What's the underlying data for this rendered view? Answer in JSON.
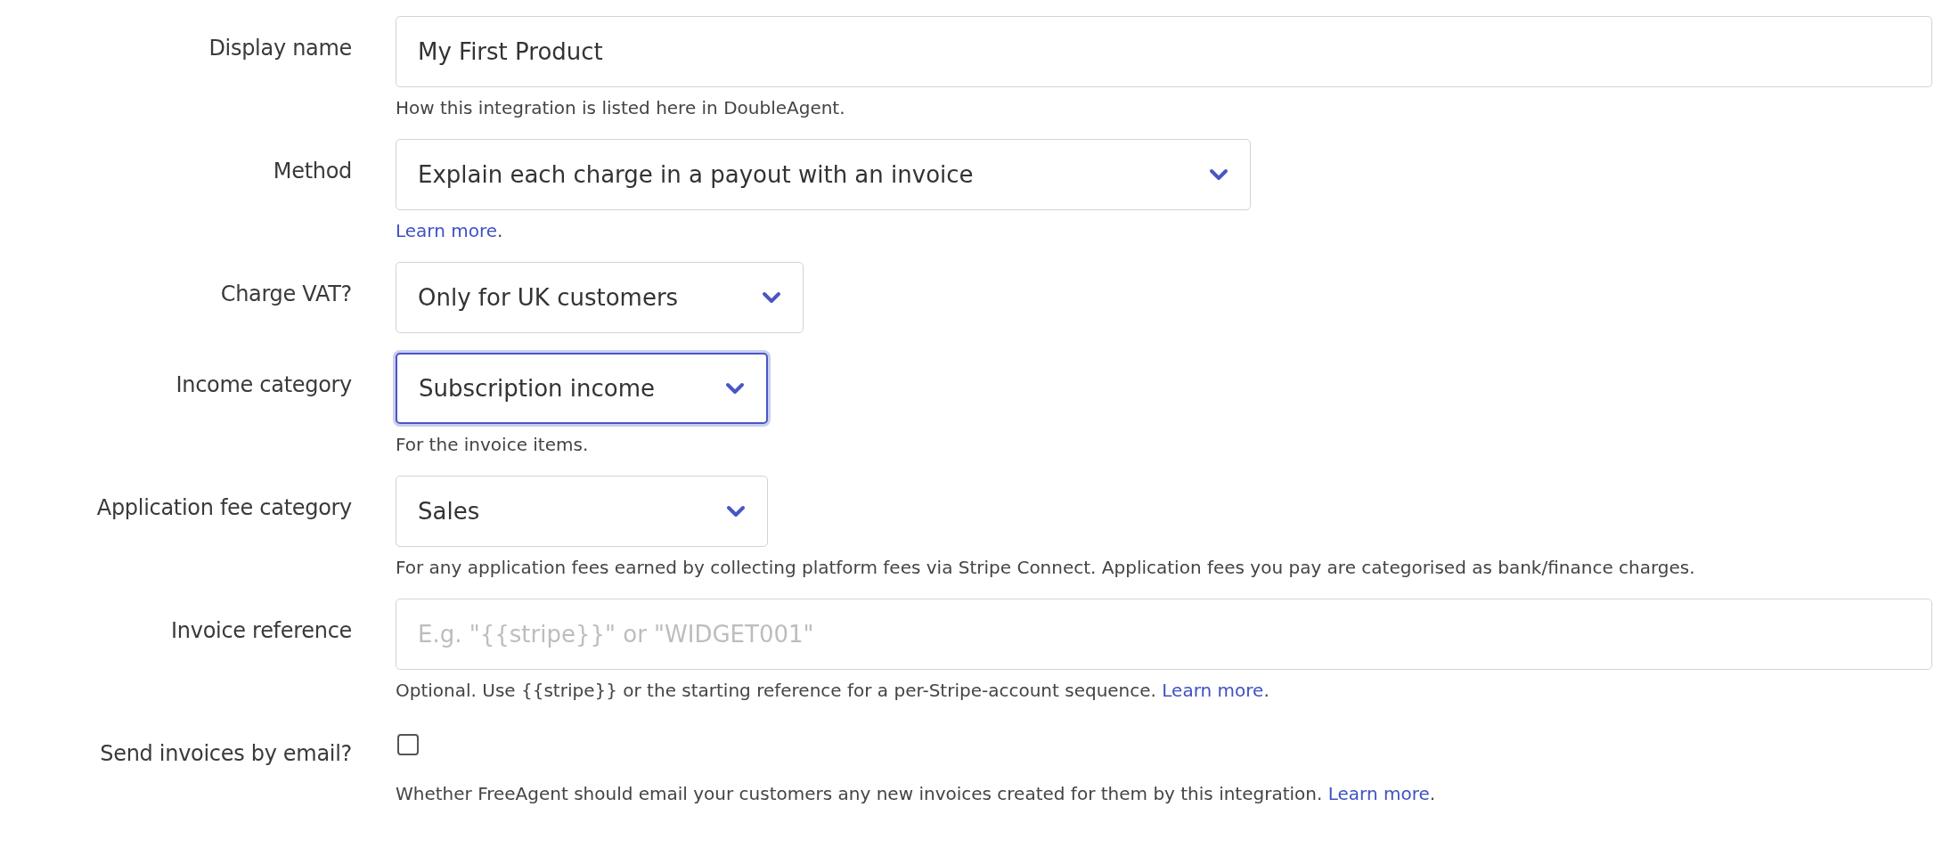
{
  "fields": [
    {
      "kind": "text",
      "label": "Display name",
      "value": "My First Product",
      "help": [
        {
          "kind": "text",
          "text": "How this integration is listed here in DoubleAgent."
        }
      ]
    },
    {
      "kind": "select",
      "label": "Method",
      "value": "Explain each charge in a payout with an invoice",
      "focused": false,
      "help": [
        {
          "kind": "link",
          "text": "Learn more"
        },
        {
          "kind": "text",
          "text": "."
        }
      ]
    },
    {
      "kind": "select",
      "label": "Charge VAT?",
      "value": "Only for UK customers",
      "focused": false
    },
    {
      "kind": "select",
      "label": "Income category",
      "value": "Subscription income",
      "focused": true,
      "help": [
        {
          "kind": "text",
          "text": "For the invoice items."
        }
      ]
    },
    {
      "kind": "select",
      "label": "Application fee category",
      "value": "Sales",
      "focused": false,
      "help": [
        {
          "kind": "text",
          "text": "For any application fees earned by collecting platform fees via Stripe Connect. Application fees you pay are categorised as bank/finance charges."
        }
      ]
    },
    {
      "kind": "text",
      "label": "Invoice reference",
      "placeholder": "E.g. \"{{stripe}}\" or \"WIDGET001\"",
      "help": [
        {
          "kind": "text",
          "text": "Optional. Use {{stripe}} or the starting reference for a per-Stripe-account sequence. "
        },
        {
          "kind": "link",
          "text": "Learn more"
        },
        {
          "kind": "text",
          "text": "."
        }
      ]
    },
    {
      "kind": "checkbox",
      "label": "Send invoices by email?",
      "checked": false,
      "help": [
        {
          "kind": "text",
          "text": "Whether FreeAgent should email your customers any new invoices created for them by this integration. "
        },
        {
          "kind": "link",
          "text": "Learn more"
        },
        {
          "kind": "text",
          "text": "."
        }
      ]
    }
  ]
}
